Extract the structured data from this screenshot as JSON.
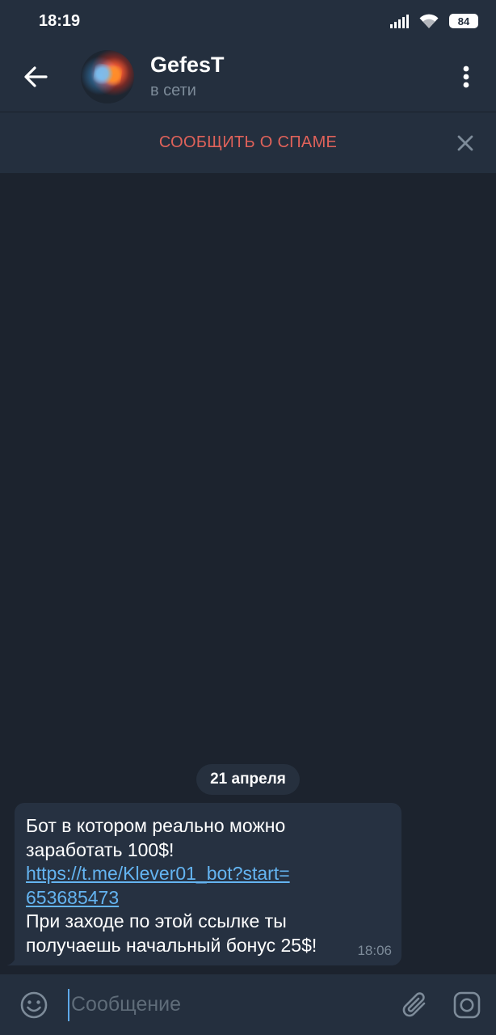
{
  "status_bar": {
    "time": "18:19",
    "battery": "84",
    "icons": [
      "signal-icon",
      "wifi-icon",
      "battery-icon"
    ]
  },
  "header": {
    "back_icon": "arrow-left-icon",
    "name": "GefesT",
    "status": "в сети",
    "menu_icon": "more-vertical-icon"
  },
  "spam_bar": {
    "report_label": "СООБЩИТЬ О СПАМЕ",
    "close_icon": "close-icon"
  },
  "chat": {
    "date": "21 апреля",
    "message": {
      "line1": "Бот в котором реально можно",
      "line2": "заработать 100$!",
      "link_line1": "https://t.me/Klever01_bot?start=",
      "link_line2": "653685473",
      "line3": "При заходе по этой ссылке ты",
      "line4": "получаешь начальный бонус 25$!",
      "time": "18:06"
    }
  },
  "composer": {
    "placeholder": "Сообщение",
    "value": "",
    "emoji_icon": "emoji-icon",
    "attach_icon": "paperclip-icon",
    "camera_icon": "instagram-camera-icon"
  },
  "colors": {
    "background": "#1c232e",
    "bars": "#242f3e",
    "bubble": "#263141",
    "link": "#64b4f1",
    "spam": "#e0625a",
    "muted": "#7d8b99"
  }
}
